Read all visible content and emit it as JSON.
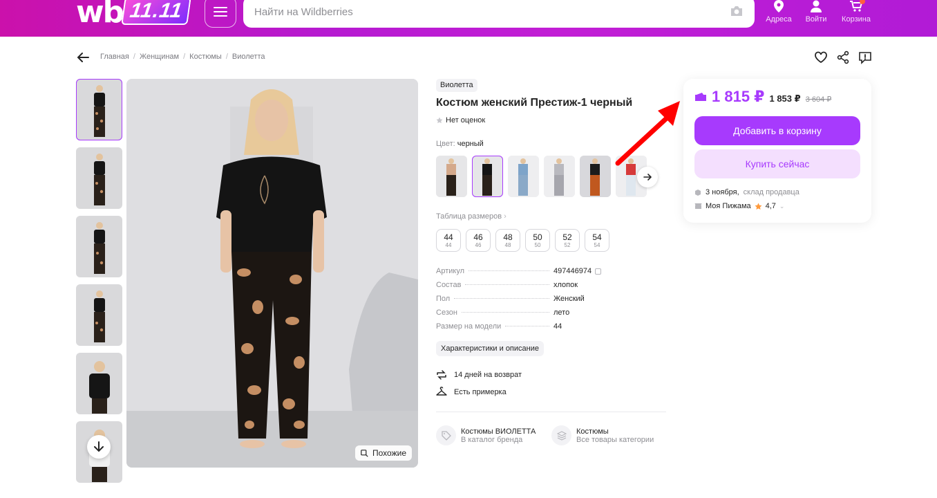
{
  "header": {
    "logo": "wb",
    "logo_badge": "11.11",
    "search_placeholder": "Найти на Wildberries",
    "nav": [
      {
        "label": "Адреса",
        "icon": "location-pin-icon"
      },
      {
        "label": "Войти",
        "icon": "user-icon"
      },
      {
        "label": "Корзина",
        "icon": "cart-icon"
      }
    ]
  },
  "breadcrumb": [
    "Главная",
    "Женщинам",
    "Костюмы",
    "Виолетта"
  ],
  "gallery": {
    "thumb_count": 6,
    "similar_label": "Похожие"
  },
  "product": {
    "brand": "Виолетта",
    "title": "Костюм женский Престиж-1 черный",
    "rating_text": "Нет оценок",
    "color_label": "Цвет:",
    "color_value": "черный",
    "size_table_label": "Таблица размеров",
    "sizes": [
      {
        "main": "44",
        "sub": "44"
      },
      {
        "main": "46",
        "sub": "46"
      },
      {
        "main": "48",
        "sub": "48"
      },
      {
        "main": "50",
        "sub": "50"
      },
      {
        "main": "52",
        "sub": "52"
      },
      {
        "main": "54",
        "sub": "54"
      }
    ],
    "specs": [
      {
        "key": "Артикул",
        "value": "497446974"
      },
      {
        "key": "Состав",
        "value": "хлопок"
      },
      {
        "key": "Пол",
        "value": "Женский"
      },
      {
        "key": "Сезон",
        "value": "лето"
      },
      {
        "key": "Размер на модели",
        "value": "44"
      }
    ],
    "description_button": "Характеристики и описание",
    "features": [
      {
        "label": "14 дней на возврат",
        "icon": "return-arrows-icon"
      },
      {
        "label": "Есть примерка",
        "icon": "hanger-icon"
      }
    ],
    "links": [
      {
        "title": "Костюмы ВИОЛЕТТА",
        "subtitle": "В каталог бренда",
        "icon": "tag-icon"
      },
      {
        "title": "Костюмы",
        "subtitle": "Все товары категории",
        "icon": "layers-icon"
      }
    ]
  },
  "buybox": {
    "price": "1 815 ₽",
    "price_alt": "1 853 ₽",
    "price_old": "3 604 ₽",
    "add_to_cart": "Добавить в корзину",
    "buy_now": "Купить сейчас",
    "delivery_date": "3 ноября,",
    "delivery_source": "склад продавца",
    "seller_name": "Моя Пижама",
    "seller_rating": "4,7"
  },
  "colors": {
    "accent": "#a73afd",
    "header_gradient_start": "#cb11ab",
    "header_gradient_end": "#b11bd6",
    "annotation_arrow": "#ff0000"
  }
}
